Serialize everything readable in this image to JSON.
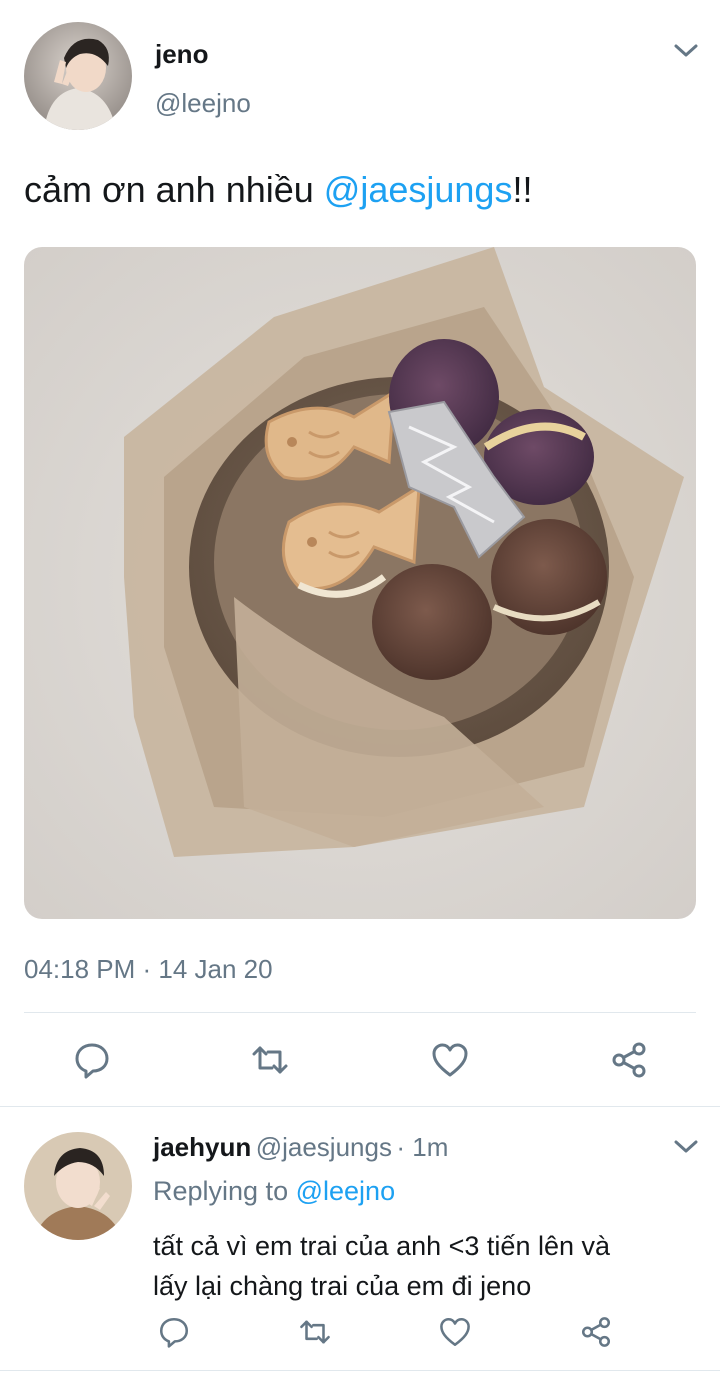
{
  "tweet": {
    "author_name": "jeno",
    "author_handle": "@leejno",
    "text_prefix": "cảm ơn anh nhiều ",
    "text_mention": "@jaesjungs",
    "text_suffix": "!!",
    "timestamp": "04:18 PM · 14 Jan 20",
    "media_description_icon": "photo-of-cookies-and-macarons"
  },
  "reply": {
    "author_name": "jaehyun",
    "author_handle": "@jaesjungs",
    "time": "· 1m",
    "replying_label": "Replying to",
    "replying_to": "@leejno",
    "text_line1": "tất cả vì em trai của anh <3 tiến lên và",
    "text_line2": "lấy lại chàng trai của em đi jeno"
  },
  "colors": {
    "accent": "#1da1f2",
    "secondary_text": "#657786",
    "icon": "#657786",
    "divider": "#e1e8ed"
  }
}
